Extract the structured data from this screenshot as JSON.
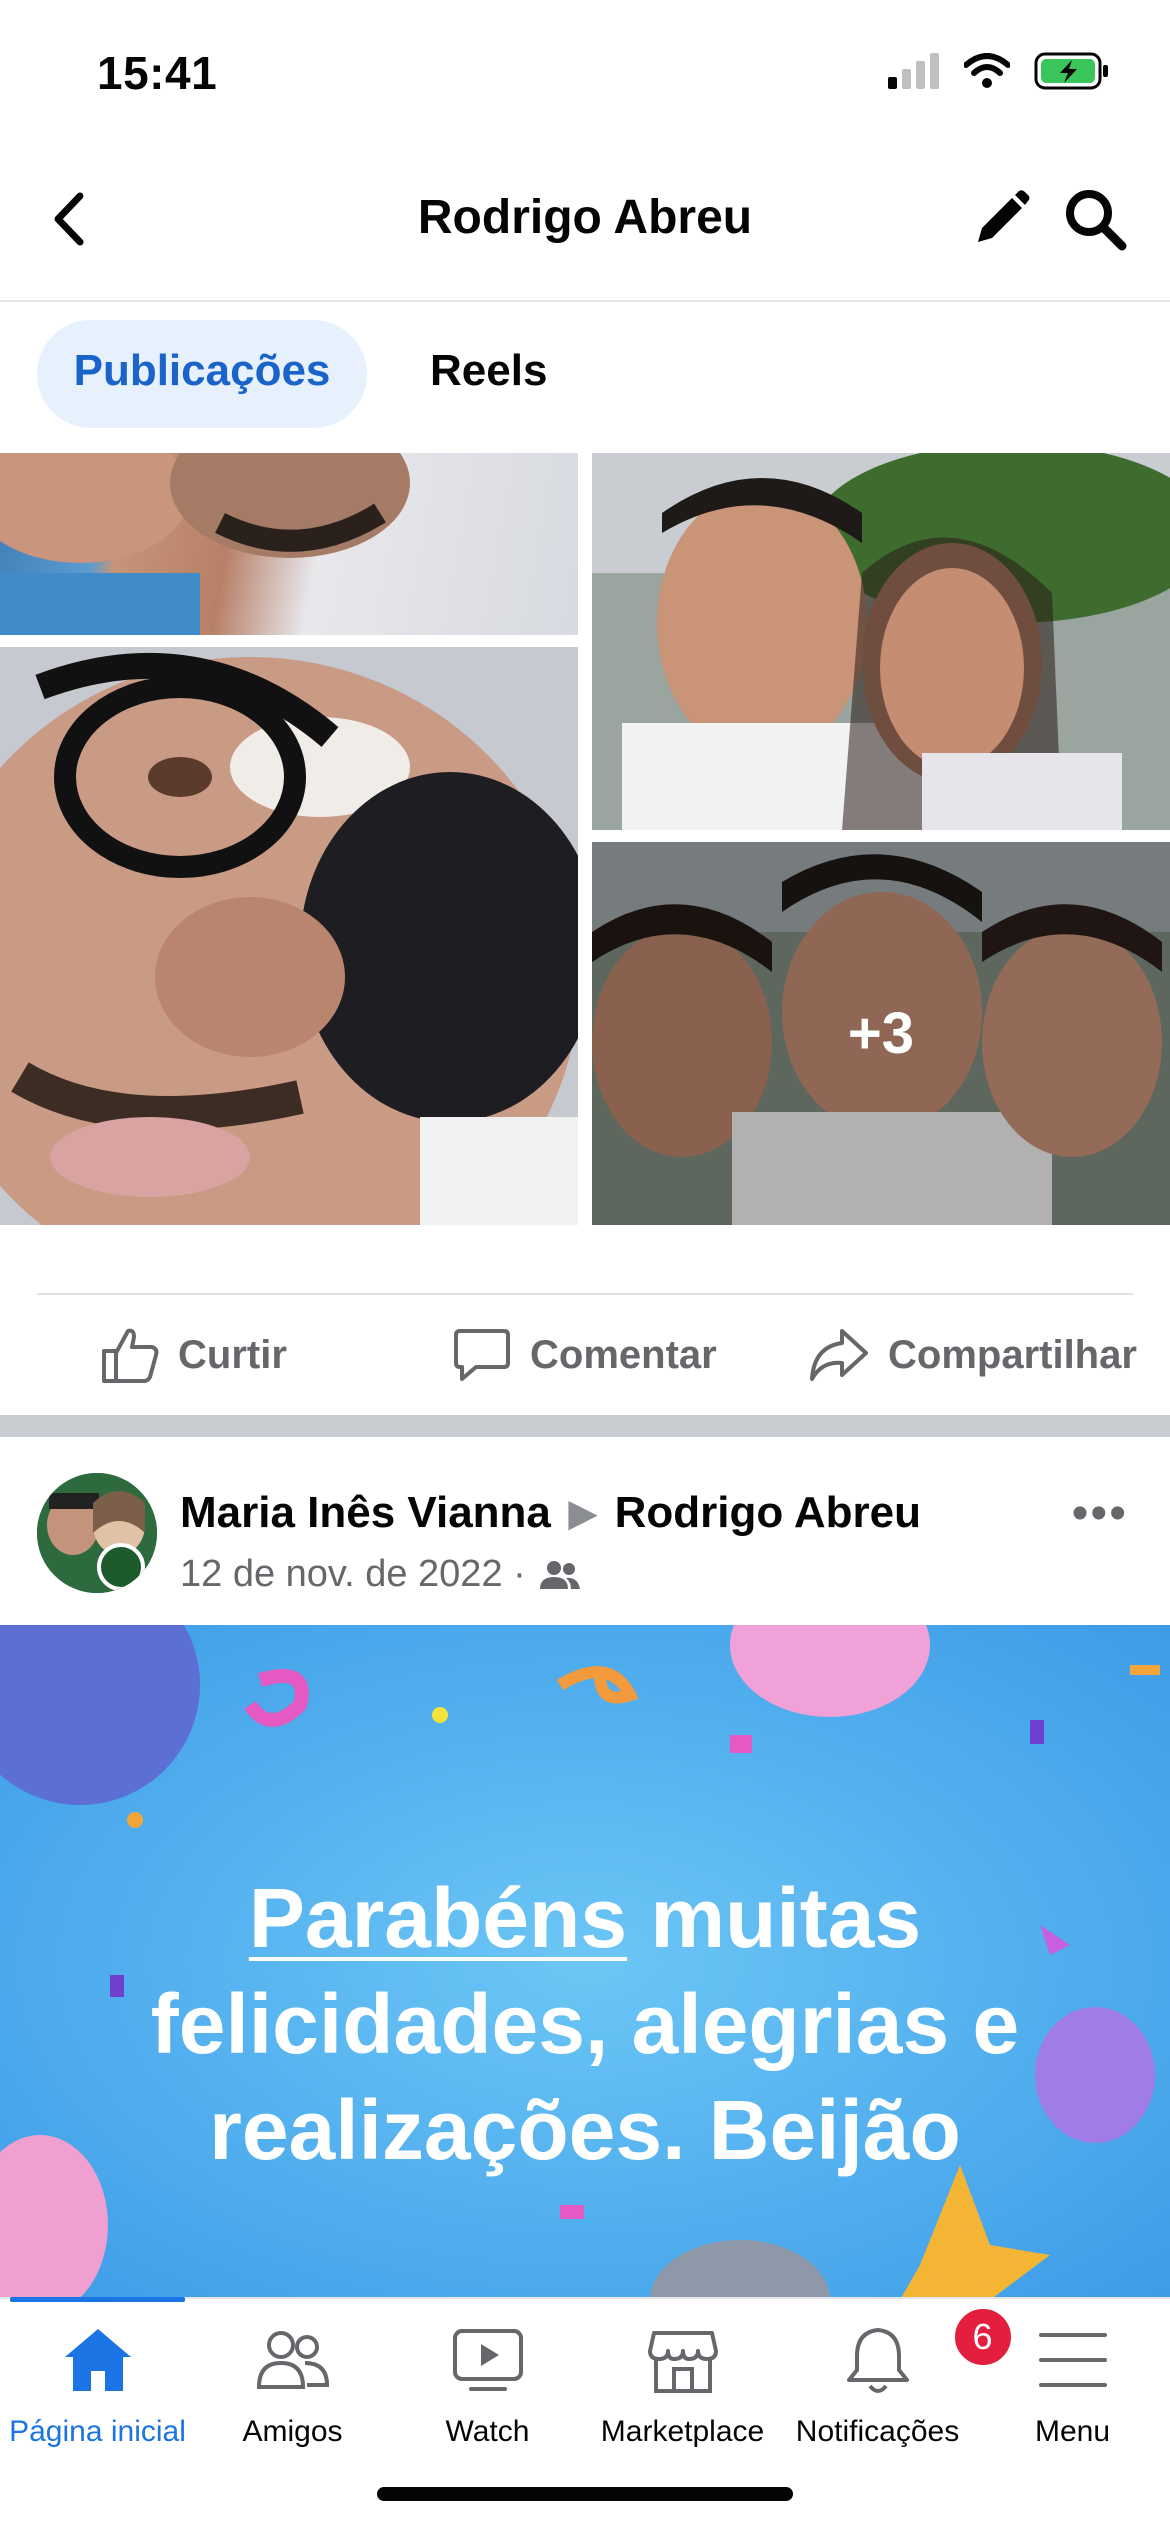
{
  "status_bar": {
    "time": "15:41"
  },
  "header": {
    "title": "Rodrigo Abreu",
    "back_icon": "chevron-left-icon",
    "edit_icon": "pencil-icon",
    "search_icon": "search-icon"
  },
  "tabs": [
    {
      "label": "Publicações",
      "active": true
    },
    {
      "label": "Reels",
      "active": false
    }
  ],
  "photo_grid": {
    "more_count": "+3"
  },
  "actions": {
    "like": "Curtir",
    "comment": "Comentar",
    "share": "Compartilhar"
  },
  "post": {
    "author": "Maria Inês Vianna",
    "target": "Rodrigo Abreu",
    "date": "12 de nov. de 2022 ·",
    "audience_icon": "friends-icon",
    "banner": {
      "word1": "Parabéns",
      "line1_rest": " muitas",
      "line2": "felicidades, alegrias e",
      "line3": "realizações. Beijão",
      "background": "#5bb3f1"
    }
  },
  "bottom_nav": {
    "home": "Página inicial",
    "friends": "Amigos",
    "watch": "Watch",
    "marketplace": "Marketplace",
    "notifications": "Notificações",
    "notifications_badge": "6",
    "menu": "Menu",
    "accent": "#1b74e4"
  }
}
